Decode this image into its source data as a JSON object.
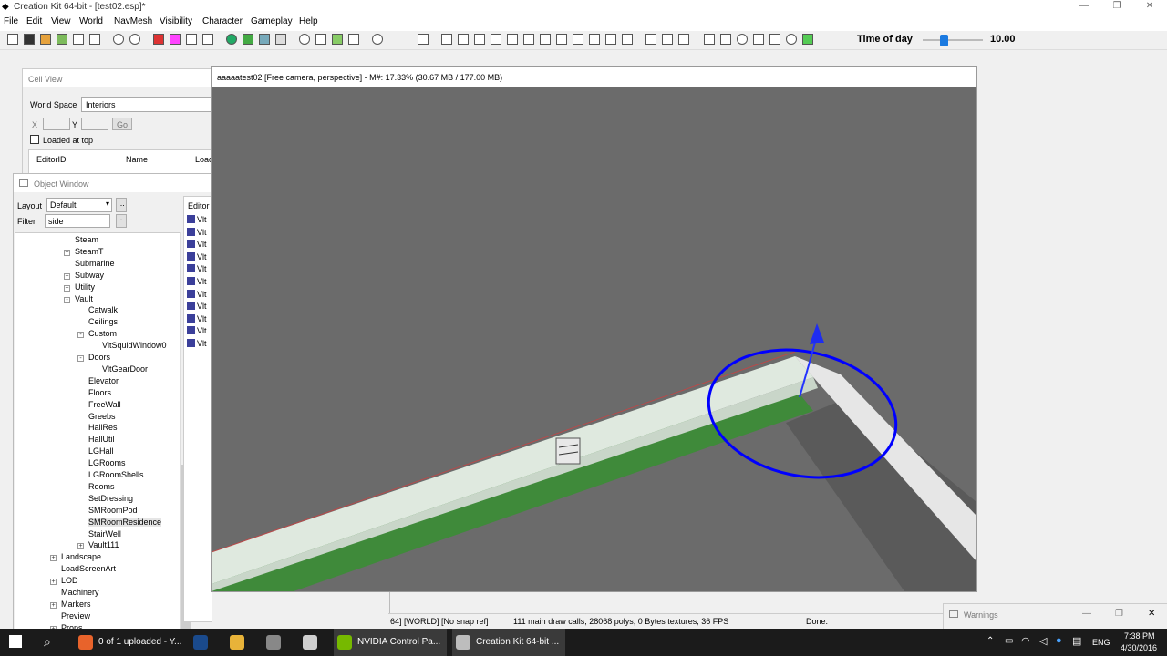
{
  "window": {
    "title": "Creation Kit 64-bit - [test02.esp]*"
  },
  "menu": [
    "File",
    "Edit",
    "View",
    "World",
    "NavMesh",
    "Visibility",
    "Character",
    "Gameplay",
    "Help"
  ],
  "toolbar": {
    "time_of_day_label": "Time of day",
    "time_of_day_value": "10.00",
    "time_of_day_fraction": 0.35
  },
  "cell_view": {
    "title": "Cell View",
    "world_space_label": "World Space",
    "world_space_value": "Interiors",
    "x_label": "X",
    "y_label": "Y",
    "go_label": "Go",
    "loaded_at_top": "Loaded at top",
    "columns": [
      "EditorID",
      "Name",
      "Load"
    ]
  },
  "object_window": {
    "title": "Object Window",
    "layout_label": "Layout",
    "layout_value": "Default",
    "filter_label": "Filter",
    "filter_value": "side",
    "more_button": "...",
    "clear_button": "-",
    "editor_column": "Editor",
    "tree": [
      {
        "label": "Steam",
        "depth": 2,
        "exp": ""
      },
      {
        "label": "SteamT",
        "depth": 2,
        "exp": "+"
      },
      {
        "label": "Submarine",
        "depth": 2,
        "exp": ""
      },
      {
        "label": "Subway",
        "depth": 2,
        "exp": "+"
      },
      {
        "label": "Utility",
        "depth": 2,
        "exp": "+"
      },
      {
        "label": "Vault",
        "depth": 2,
        "exp": "-"
      },
      {
        "label": "Catwalk",
        "depth": 3,
        "exp": ""
      },
      {
        "label": "Ceilings",
        "depth": 3,
        "exp": ""
      },
      {
        "label": "Custom",
        "depth": 3,
        "exp": "-"
      },
      {
        "label": "VltSquidWindow0",
        "depth": 4,
        "exp": ""
      },
      {
        "label": "Doors",
        "depth": 3,
        "exp": "-"
      },
      {
        "label": "VltGearDoor",
        "depth": 4,
        "exp": ""
      },
      {
        "label": "Elevator",
        "depth": 3,
        "exp": ""
      },
      {
        "label": "Floors",
        "depth": 3,
        "exp": ""
      },
      {
        "label": "FreeWall",
        "depth": 3,
        "exp": ""
      },
      {
        "label": "Greebs",
        "depth": 3,
        "exp": ""
      },
      {
        "label": "HallRes",
        "depth": 3,
        "exp": ""
      },
      {
        "label": "HallUtil",
        "depth": 3,
        "exp": ""
      },
      {
        "label": "LGHall",
        "depth": 3,
        "exp": ""
      },
      {
        "label": "LGRooms",
        "depth": 3,
        "exp": ""
      },
      {
        "label": "LGRoomShells",
        "depth": 3,
        "exp": ""
      },
      {
        "label": "Rooms",
        "depth": 3,
        "exp": ""
      },
      {
        "label": "SetDressing",
        "depth": 3,
        "exp": ""
      },
      {
        "label": "SMRoomPod",
        "depth": 3,
        "exp": ""
      },
      {
        "label": "SMRoomResidence",
        "depth": 3,
        "exp": ""
      },
      {
        "label": "StairWell",
        "depth": 3,
        "exp": ""
      },
      {
        "label": "Vault111",
        "depth": 3,
        "exp": "+"
      },
      {
        "label": "Landscape",
        "depth": 0,
        "exp": "+"
      },
      {
        "label": "LoadScreenArt",
        "depth": 0,
        "exp": ""
      },
      {
        "label": "LOD",
        "depth": 0,
        "exp": "+"
      },
      {
        "label": "Machinery",
        "depth": 0,
        "exp": ""
      },
      {
        "label": "Markers",
        "depth": 0,
        "exp": "+"
      },
      {
        "label": "Preview",
        "depth": 0,
        "exp": ""
      },
      {
        "label": "Props",
        "depth": 0,
        "exp": "+"
      }
    ],
    "editor_items": [
      "Vlt",
      "Vlt",
      "Vlt",
      "Vlt",
      "Vlt",
      "Vlt",
      "Vlt",
      "Vlt",
      "Vlt",
      "Vlt",
      "Vlt"
    ]
  },
  "render_window": {
    "title": "aaaaatest02 [Free camera, perspective] - M#: 17.33% (30.67 MB / 177.00 MB)"
  },
  "status_bar": {
    "ref": "64] [WORLD] [No snap ref]",
    "stats": "111 main draw calls, 28068 polys, 0 Bytes textures, 36 FPS",
    "state": "Done."
  },
  "warnings": {
    "title": "Warnings"
  },
  "taskbar": {
    "items": [
      {
        "label": "0 of 1 uploaded - Y...",
        "color": "#e8632b"
      },
      {
        "label": "",
        "color": "#1a4a8c"
      },
      {
        "label": "",
        "color": "#e8b339"
      },
      {
        "label": "",
        "color": "#888888"
      },
      {
        "label": "",
        "color": "#cfcfcf"
      },
      {
        "label": "NVIDIA Control Pa...",
        "color": "#76b900"
      },
      {
        "label": "Creation Kit 64-bit ...",
        "color": "#bdbdbd"
      }
    ],
    "language": "ENG",
    "time": "7:38 PM",
    "date": "4/30/2016"
  },
  "colors": {
    "gizmo": "#0000ff",
    "floor_green": "#3f8a3a",
    "wall": "#dfe9df",
    "accent": "#1b7ae0"
  }
}
